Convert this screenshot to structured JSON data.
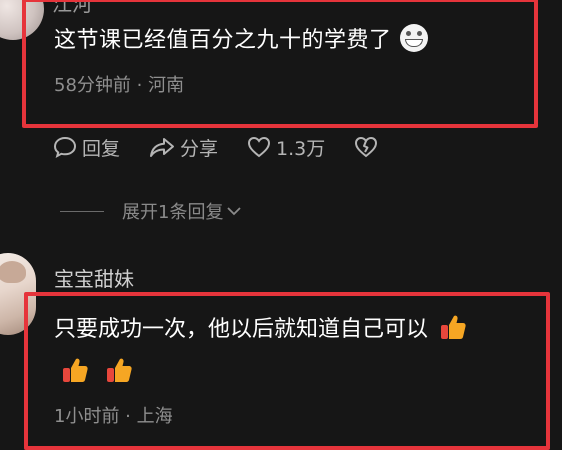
{
  "comments": [
    {
      "username": "",
      "text": "这节课已经值百分之九十的学费了",
      "emoji": "grin-emoji",
      "meta": "58分钟前 · 河南"
    },
    {
      "username": "宝宝甜妹",
      "text": "只要成功一次，他以后就知道自己可以",
      "emoji": "thumbs-up-emoji",
      "meta": "1小时前 · 上海"
    }
  ],
  "top_clipped_name": "江河",
  "actions": {
    "reply_label": "回复",
    "share_label": "分享",
    "like_count": "1.3万"
  },
  "expand_replies": "展开1条回复",
  "colors": {
    "background": "#161616",
    "highlight_box": "#e6343b",
    "muted_text": "#8f8f8f"
  }
}
